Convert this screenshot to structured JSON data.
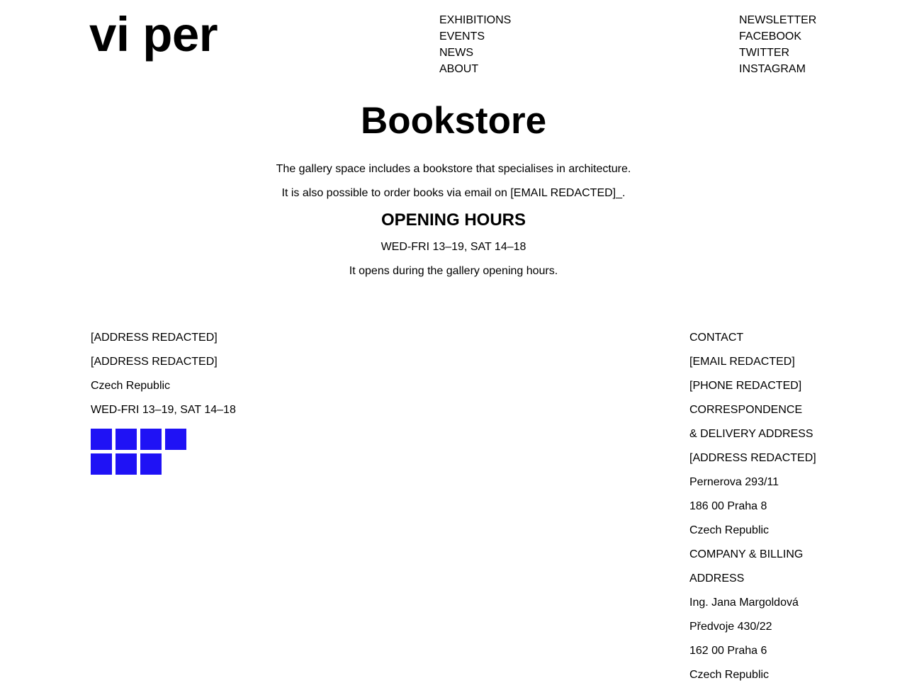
{
  "header": {
    "logo": "vi per",
    "nav_main": [
      "EXHIBITIONS",
      "EVENTS",
      "NEWS",
      "ABOUT"
    ],
    "nav_social": [
      "NEWSLETTER",
      "FACEBOOK",
      "TWITTER",
      "INSTAGRAM"
    ]
  },
  "main": {
    "title": "Bookstore",
    "intro": "The gallery space includes a bookstore that specialises in architecture.",
    "order": "It is also possible to order books via email on [EMAIL REDACTED]_.",
    "hours_heading": "OPENING HOURS",
    "hours": "WED-FRI 13–19, SAT 14–18",
    "hours_note": "It opens during the gallery opening hours."
  },
  "footer": {
    "left": {
      "lines": [
        "[ADDRESS REDACTED]",
        "[ADDRESS REDACTED]",
        "Czech Republic",
        "WED-FRI 13–19, SAT 14–18"
      ],
      "square_color": "#1f12f5",
      "square_count": 7
    },
    "right": {
      "lines": [
        "CONTACT",
        "[EMAIL REDACTED]",
        "[PHONE REDACTED]",
        "CORRESPONDENCE",
        "& DELIVERY ADDRESS",
        "[ADDRESS REDACTED]",
        "Pernerova 293/11",
        "186 00 Praha 8",
        "Czech Republic",
        "COMPANY & BILLING",
        "ADDRESS",
        "Ing. Jana Margoldová",
        "Předvoje 430/22",
        "162 00 Praha 6",
        "Czech Republic"
      ]
    }
  }
}
